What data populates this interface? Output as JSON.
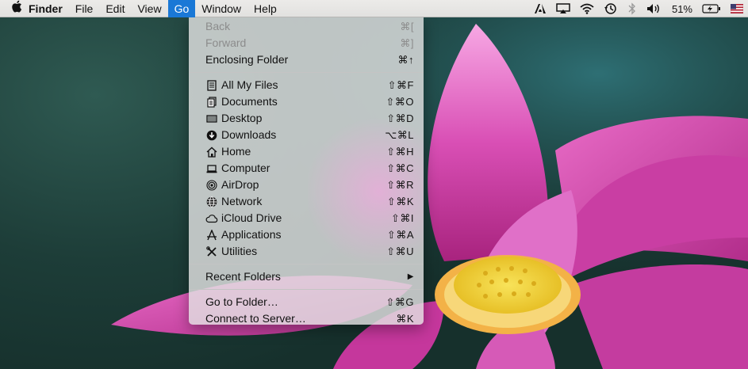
{
  "menubar": {
    "app_name": "Finder",
    "menus": [
      "File",
      "Edit",
      "View",
      "Go",
      "Window",
      "Help"
    ],
    "active_menu": "Go",
    "battery": "51%"
  },
  "go_menu": {
    "nav": [
      {
        "label": "Back",
        "shortcut": "⌘[",
        "enabled": false
      },
      {
        "label": "Forward",
        "shortcut": "⌘]",
        "enabled": false
      },
      {
        "label": "Enclosing Folder",
        "shortcut": "⌘↑",
        "enabled": true
      }
    ],
    "places": [
      {
        "label": "All My Files",
        "shortcut": "⇧⌘F",
        "icon": "all-files-icon"
      },
      {
        "label": "Documents",
        "shortcut": "⇧⌘O",
        "icon": "documents-icon"
      },
      {
        "label": "Desktop",
        "shortcut": "⇧⌘D",
        "icon": "desktop-icon"
      },
      {
        "label": "Downloads",
        "shortcut": "⌥⌘L",
        "icon": "downloads-icon"
      },
      {
        "label": "Home",
        "shortcut": "⇧⌘H",
        "icon": "home-icon"
      },
      {
        "label": "Computer",
        "shortcut": "⇧⌘C",
        "icon": "computer-icon"
      },
      {
        "label": "AirDrop",
        "shortcut": "⇧⌘R",
        "icon": "airdrop-icon"
      },
      {
        "label": "Network",
        "shortcut": "⇧⌘K",
        "icon": "network-icon"
      },
      {
        "label": "iCloud Drive",
        "shortcut": "⇧⌘I",
        "icon": "icloud-icon"
      },
      {
        "label": "Applications",
        "shortcut": "⇧⌘A",
        "icon": "applications-icon"
      },
      {
        "label": "Utilities",
        "shortcut": "⇧⌘U",
        "icon": "utilities-icon"
      }
    ],
    "recent": {
      "label": "Recent Folders",
      "submenu_arrow": "▶"
    },
    "goto": [
      {
        "label": "Go to Folder…",
        "shortcut": "⇧⌘G"
      },
      {
        "label": "Connect to Server…",
        "shortcut": "⌘K"
      }
    ]
  },
  "colors": {
    "highlight": "#1a78d6",
    "petal": "#d94fb5",
    "center": "#f2d43a"
  }
}
